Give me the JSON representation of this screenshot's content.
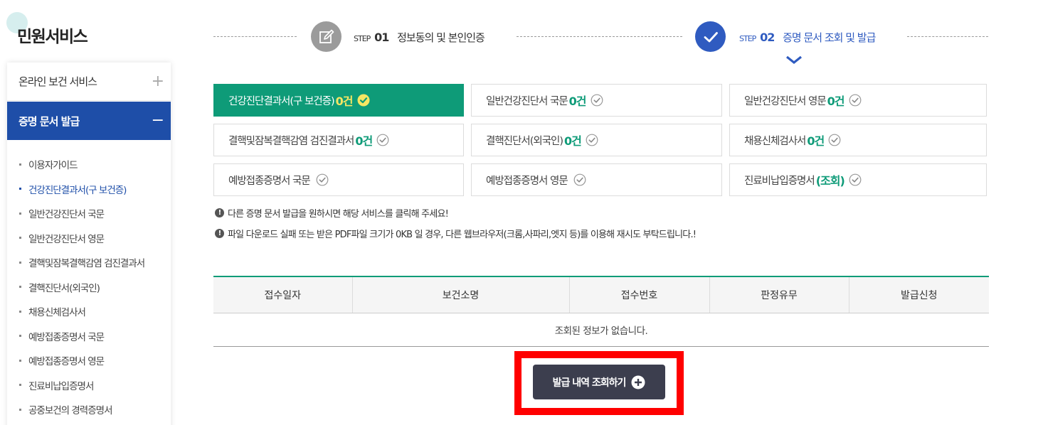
{
  "page": {
    "title": "민원서비스"
  },
  "sidebar": {
    "menus": [
      {
        "label": "온라인 보건 서비스",
        "toggle": "+"
      },
      {
        "label": "증명 문서 발급",
        "toggle": "−"
      }
    ],
    "sub_items": [
      {
        "label": "이용자가이드"
      },
      {
        "label": "건강진단결과서(구 보건증)"
      },
      {
        "label": "일반건강진단서 국문"
      },
      {
        "label": "일반건강진단서 영문"
      },
      {
        "label": "결핵및잠복결핵감염 검진결과서"
      },
      {
        "label": "결핵진단서(외국인)"
      },
      {
        "label": "채용신체검사서"
      },
      {
        "label": "예방접종증명서 국문"
      },
      {
        "label": "예방접종증명서 영문"
      },
      {
        "label": "진료비납입증명서"
      },
      {
        "label": "공중보건의 경력증명서"
      }
    ],
    "current_index": 1
  },
  "steps": [
    {
      "prefix": "STEP",
      "number": "01",
      "label": "정보동의 및 본인인증",
      "icon": "pencil-edit-icon",
      "state": "done"
    },
    {
      "prefix": "STEP",
      "number": "02",
      "label": "증명 문서 조회 및 발급",
      "icon": "check-icon",
      "state": "current"
    }
  ],
  "documents": [
    {
      "label": "건강진단결과서(구 보건증)",
      "count": "0건",
      "selected": true
    },
    {
      "label": "일반건강진단서 국문",
      "count": "0건",
      "selected": false
    },
    {
      "label": "일반건강진단서 영문",
      "count": "0건",
      "selected": false
    },
    {
      "label": "결핵및잠복결핵감염 검진결과서",
      "count": "0건",
      "selected": false
    },
    {
      "label": "결핵진단서(외국인)",
      "count": "0건",
      "selected": false
    },
    {
      "label": "채용신체검사서",
      "count": "0건",
      "selected": false
    },
    {
      "label": "예방접종증명서 국문",
      "count": "",
      "selected": false
    },
    {
      "label": "예방접종증명서 영문",
      "count": "",
      "selected": false
    },
    {
      "label": "진료비납입증명서",
      "count": "(조회)",
      "selected": false
    }
  ],
  "notices": [
    "다른 증명 문서 발급을 원하시면 해당 서비스를 클릭해 주세요!",
    "파일 다운로드 실패 또는 받은 PDF파일 크기가 0KB 일 경우, 다른 웹브라우저(크롬,사파리,엣지 등)를 이용해 재시도 부탁드립니다.!"
  ],
  "table": {
    "headers": [
      "접수일자",
      "보건소명",
      "접수번호",
      "판정유무",
      "발급신청"
    ],
    "empty_message": "조회된 정보가 없습니다."
  },
  "lookup_button": {
    "label": "발급 내역 조회하기"
  },
  "colors": {
    "primary_blue": "#1e4ea8",
    "step_blue": "#2f5bc0",
    "accent_green": "#0e9b78",
    "count_yellow": "#f5e663",
    "button_dark": "#3c3e4e",
    "highlight_red": "#ff0000"
  }
}
